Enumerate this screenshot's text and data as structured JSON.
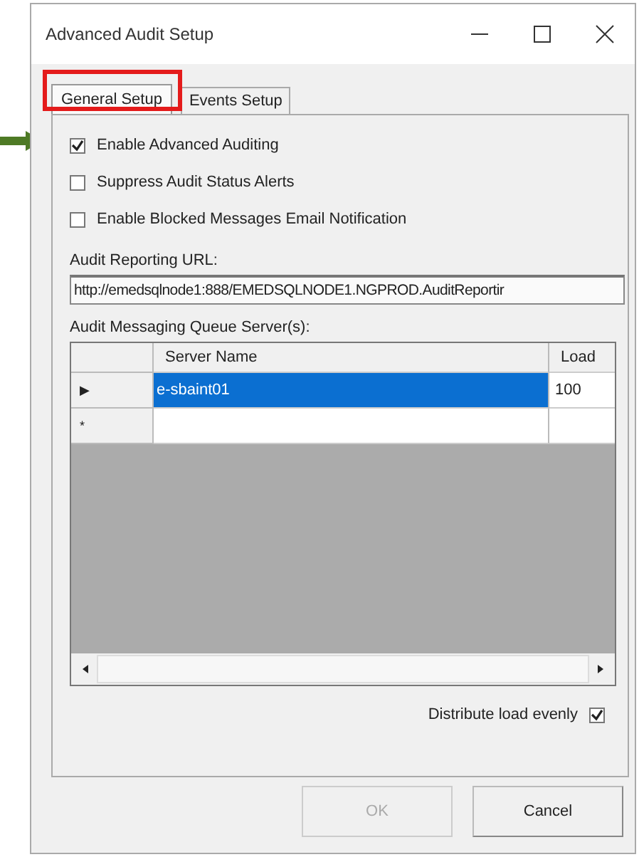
{
  "window": {
    "title": "Advanced Audit Setup"
  },
  "tabs": [
    {
      "label": "General Setup",
      "selected": true
    },
    {
      "label": "Events Setup",
      "selected": false
    }
  ],
  "options": [
    {
      "label": "Enable Advanced Auditing",
      "checked": true
    },
    {
      "label": "Suppress Audit Status Alerts",
      "checked": false
    },
    {
      "label": "Enable Blocked Messages Email Notification",
      "checked": false
    }
  ],
  "url_label": "Audit Reporting URL:",
  "url_value": "http://emedsqlnode1:888/EMEDSQLNODE1.NGPROD.AuditReportir",
  "queue_label": "Audit Messaging Queue Server(s):",
  "grid": {
    "columns": [
      "Server Name",
      "Load"
    ],
    "rows": [
      {
        "indicator": "▶",
        "cells": [
          "e-sbaint01",
          "100"
        ],
        "selected": true
      },
      {
        "indicator": "*",
        "cells": [],
        "selected": false
      }
    ]
  },
  "distribute": {
    "label": "Distribute load evenly",
    "checked": true
  },
  "buttons": [
    {
      "label": "OK",
      "disabled": true
    },
    {
      "label": "Cancel",
      "disabled": false
    }
  ]
}
